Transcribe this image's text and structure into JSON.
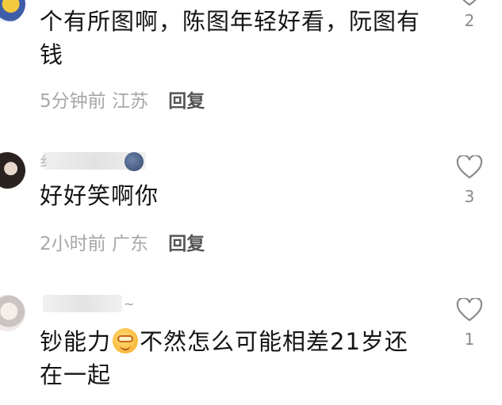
{
  "comments": [
    {
      "text": "个有所图啊，陈图年轻好看，阮图有钱",
      "time": "5分钟前",
      "location": "江苏",
      "reply_label": "回复",
      "likes": "2"
    },
    {
      "username_prefix": "纟",
      "text": "好好笑啊你",
      "time": "2小时前",
      "location": "广东",
      "reply_label": "回复",
      "likes": "3"
    },
    {
      "text_before_emoji": "钞能力",
      "text_after_emoji": "不然怎么可能相差21岁还在一起",
      "likes": "1"
    }
  ],
  "colors": {
    "accent_avatar_1": "#3d5da8",
    "like_icon": "#8a8a8a"
  },
  "icons": [
    "heart-outline-icon",
    "smile-emoji-icon",
    "moon-emoji-icon"
  ]
}
